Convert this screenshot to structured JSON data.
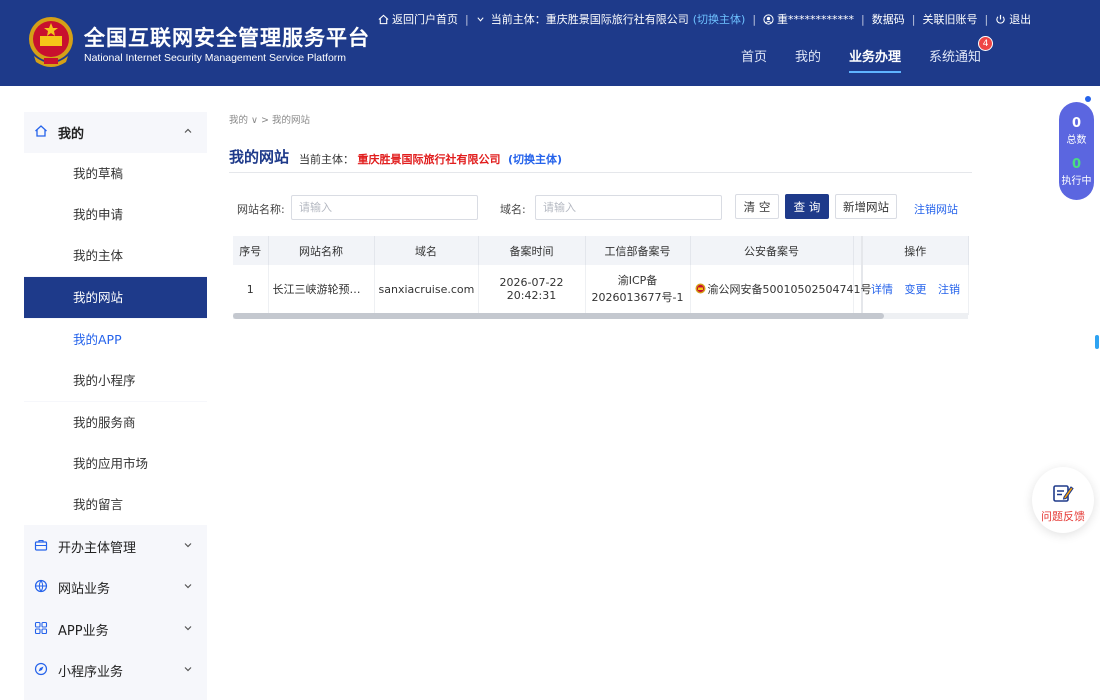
{
  "header": {
    "title_cn": "全国互联网安全管理服务平台",
    "title_en": "National Internet Security Management Service Platform",
    "topbar": {
      "home_link": "返回门户首页",
      "subject_label": "当前主体：",
      "subject_name": "重庆胜景国际旅行社有限公司",
      "switch_subject": "(切换主体)",
      "user": "重************",
      "data_code": "数据码",
      "link_account": "关联旧账号",
      "logout": "退出"
    },
    "nav": [
      {
        "label": "首页"
      },
      {
        "label": "我的"
      },
      {
        "label": "业务办理",
        "active": true
      },
      {
        "label": "系统通知",
        "badge": "4"
      }
    ]
  },
  "sidebar": {
    "group_mine": "我的",
    "items": [
      {
        "label": "我的草稿"
      },
      {
        "label": "我的申请"
      },
      {
        "label": "我的主体"
      },
      {
        "label": "我的网站",
        "active": true
      },
      {
        "label": "我的APP",
        "highlight": true
      },
      {
        "label": "我的小程序"
      },
      {
        "label": "我的服务商"
      },
      {
        "label": "我的应用市场"
      },
      {
        "label": "我的留言"
      }
    ],
    "groups": [
      {
        "label": "开办主体管理"
      },
      {
        "label": "网站业务"
      },
      {
        "label": "APP业务"
      },
      {
        "label": "小程序业务"
      }
    ]
  },
  "breadcrumb": {
    "parent": "我的",
    "current": "我的网站"
  },
  "page": {
    "title": "我的网站",
    "subject_label": "当前主体：",
    "subject_name": "重庆胜景国际旅行社有限公司",
    "switch_subject": "(切换主体)"
  },
  "filters": {
    "site_name_label": "网站名称:",
    "site_name_placeholder": "请输入",
    "domain_label": "域名:",
    "domain_placeholder": "请输入",
    "clear_button": "清 空",
    "query_button": "查 询",
    "add_button": "新增网站",
    "cancel_link": "注销网站"
  },
  "table": {
    "columns": [
      "序号",
      "网站名称",
      "域名",
      "备案时间",
      "工信部备案号",
      "公安备案号",
      "操作"
    ],
    "rows": [
      {
        "index": "1",
        "site_name": "长江三峡游轮预订...",
        "domain": "sanxiacruise.com",
        "record_time": "2026-07-22 20:42:31",
        "miit_no": "渝ICP备2026013677号-1",
        "police_no": "渝公网安备50010502504741号",
        "actions": [
          "详情",
          "变更",
          "注销"
        ]
      }
    ]
  },
  "float_counter": {
    "total_num": "0",
    "total_label": "总数",
    "running_num": "0",
    "running_label": "执行中"
  },
  "feedback": {
    "label": "问题反馈"
  },
  "colors": {
    "primary": "#1e3a8a",
    "link": "#2563eb",
    "danger": "#e11d1d"
  }
}
